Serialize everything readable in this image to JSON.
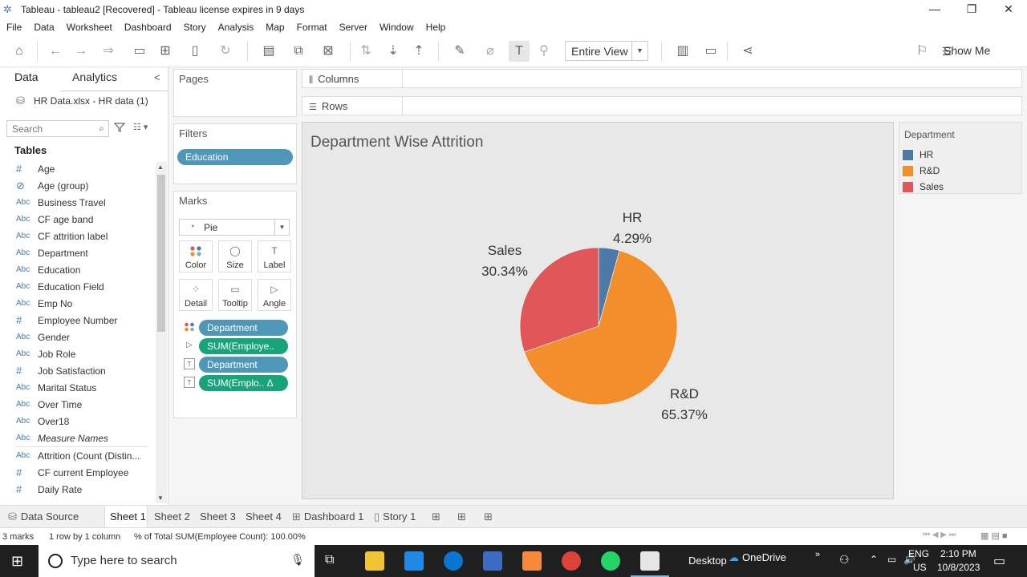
{
  "window": {
    "title": "Tableau - tableau2 [Recovered] - Tableau license expires in 9 days",
    "min": "—",
    "max": "❐",
    "close": "✕"
  },
  "menu": [
    "File",
    "Data",
    "Worksheet",
    "Dashboard",
    "Story",
    "Analysis",
    "Map",
    "Format",
    "Server",
    "Window",
    "Help"
  ],
  "toolbar": {
    "fit_label": "Entire View",
    "show_me_label": "Show Me"
  },
  "data_pane": {
    "tab_data": "Data",
    "tab_analytics": "Analytics",
    "datasource": "HR Data.xlsx - HR data (1)",
    "search_placeholder": "Search",
    "tables_heading": "Tables",
    "fields": [
      {
        "type": "#",
        "name": "Age"
      },
      {
        "type": "⊘",
        "name": "Age (group)"
      },
      {
        "type": "Abc",
        "name": "Business Travel"
      },
      {
        "type": "Abc",
        "name": "CF age band"
      },
      {
        "type": "Abc",
        "name": "CF attrition label"
      },
      {
        "type": "Abc",
        "name": "Department"
      },
      {
        "type": "Abc",
        "name": "Education"
      },
      {
        "type": "Abc",
        "name": "Education Field"
      },
      {
        "type": "Abc",
        "name": "Emp No"
      },
      {
        "type": "#",
        "name": "Employee Number"
      },
      {
        "type": "Abc",
        "name": "Gender"
      },
      {
        "type": "Abc",
        "name": "Job Role"
      },
      {
        "type": "#",
        "name": "Job Satisfaction"
      },
      {
        "type": "Abc",
        "name": "Marital Status"
      },
      {
        "type": "Abc",
        "name": "Over Time"
      },
      {
        "type": "Abc",
        "name": "Over18"
      },
      {
        "type": "Abc",
        "name": "Measure Names",
        "italic": true
      }
    ],
    "measures": [
      {
        "type": "Abc",
        "name": "Attrition (Count (Distin..."
      },
      {
        "type": "#",
        "name": "CF current Employee"
      },
      {
        "type": "#",
        "name": "Daily Rate"
      }
    ]
  },
  "pages": {
    "title": "Pages"
  },
  "filters": {
    "title": "Filters",
    "pills": [
      "Education"
    ]
  },
  "marks": {
    "title": "Marks",
    "type": "Pie",
    "buttons": [
      "Color",
      "Size",
      "Label",
      "Detail",
      "Tooltip",
      "Angle"
    ],
    "pills": [
      {
        "label": "Department",
        "color": "#4f97b8"
      },
      {
        "label": "SUM(Employe..",
        "color": "#19a37b"
      },
      {
        "label": "Department",
        "color": "#4f97b8"
      },
      {
        "label": "SUM(Emplo.. Δ",
        "color": "#19a37b"
      }
    ]
  },
  "shelves": {
    "columns": "Columns",
    "rows": "Rows"
  },
  "viz": {
    "title": "Department Wise Attrition"
  },
  "chart_data": {
    "type": "pie",
    "title": "Department Wise Attrition",
    "categories": [
      "HR",
      "R&D",
      "Sales"
    ],
    "values": [
      4.29,
      65.37,
      30.34
    ],
    "labels": [
      "4.29%",
      "65.37%",
      "30.34%"
    ],
    "colors": [
      "#4e79a7",
      "#f28e2b",
      "#e15759"
    ],
    "legend_position": "right"
  },
  "legend": {
    "title": "Department",
    "items": [
      {
        "label": "HR",
        "color": "#4e79a7"
      },
      {
        "label": "R&D",
        "color": "#f28e2b"
      },
      {
        "label": "Sales",
        "color": "#e15759"
      }
    ]
  },
  "tabs": {
    "data_source": "Data Source",
    "sheets": [
      "Sheet 1",
      "Sheet 2",
      "Sheet 3",
      "Sheet 4"
    ],
    "dashboard": "Dashboard 1",
    "story": "Story 1"
  },
  "status": {
    "marks": "3 marks",
    "rows": "1 row by 1 column",
    "total": "% of Total SUM(Employee Count): 100.00%"
  },
  "taskbar": {
    "search_placeholder": "Type here to search",
    "desktop": "Desktop",
    "onedrive": "OneDrive",
    "lang1": "ENG",
    "lang2": "US",
    "time": "2:10 PM",
    "date": "10/8/2023"
  }
}
